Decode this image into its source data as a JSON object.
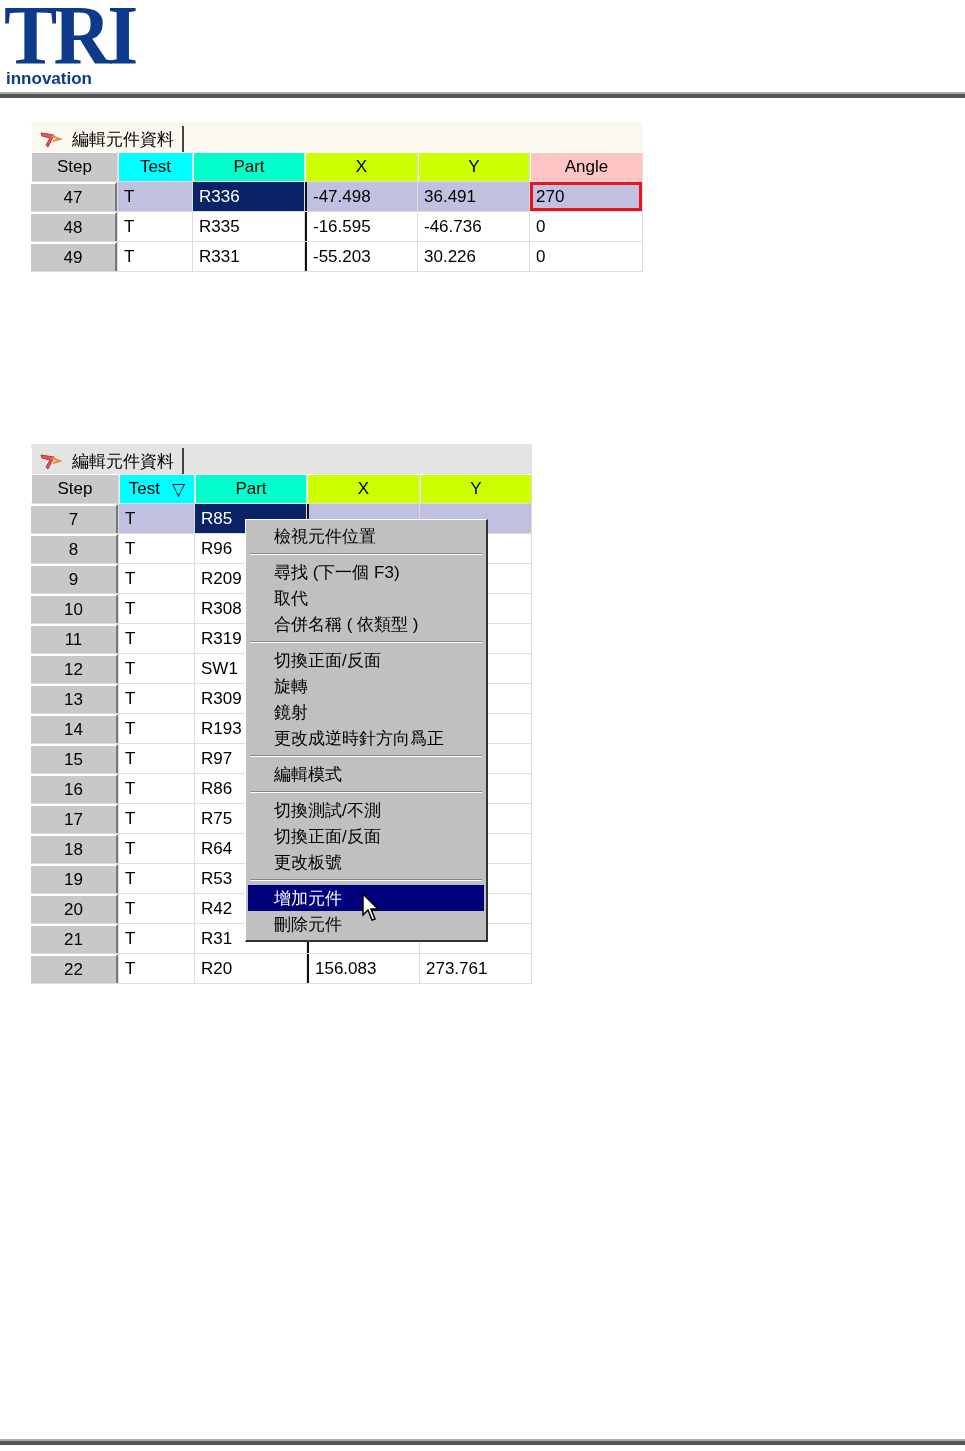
{
  "logo": {
    "mark": "TRI",
    "tagline": "innovation"
  },
  "panels": [
    {
      "title": "編輯元件資料",
      "columns": [
        {
          "label": "Step",
          "color": "#c8c8c8"
        },
        {
          "label": "Test",
          "color": "#00ffff"
        },
        {
          "label": "Part",
          "color": "#00ffcc"
        },
        {
          "label": "X",
          "color": "#ccff00"
        },
        {
          "label": "Y",
          "color": "#ccff00"
        },
        {
          "label": "Angle",
          "color": "#ffc4c4"
        }
      ],
      "rows": [
        {
          "selected": true,
          "cells": [
            "47",
            "T",
            "R336",
            "-47.498",
            "36.491",
            "270"
          ],
          "angle_outlined": true
        },
        {
          "selected": false,
          "cells": [
            "48",
            "T",
            "R335",
            "-16.595",
            "-46.736",
            "0"
          ]
        },
        {
          "selected": false,
          "cells": [
            "49",
            "T",
            "R331",
            "-55.203",
            "30.226",
            "0"
          ]
        }
      ]
    },
    {
      "title": "編輯元件資料",
      "columns": [
        {
          "label": "Step",
          "color": "#c8c8c8"
        },
        {
          "label": "Test",
          "color": "#00ffff",
          "sort_mark": "▽"
        },
        {
          "label": "Part",
          "color": "#00ffcc"
        },
        {
          "label": "X",
          "color": "#ccff00"
        },
        {
          "label": "Y",
          "color": "#ccff00"
        }
      ],
      "rows": [
        {
          "selected": true,
          "cells": [
            "7",
            "T",
            "R85",
            "",
            ""
          ]
        },
        {
          "selected": false,
          "cells": [
            "8",
            "T",
            "R96",
            "",
            ""
          ]
        },
        {
          "selected": false,
          "cells": [
            "9",
            "T",
            "R209",
            "",
            ""
          ]
        },
        {
          "selected": false,
          "cells": [
            "10",
            "T",
            "R308",
            "",
            ""
          ]
        },
        {
          "selected": false,
          "cells": [
            "11",
            "T",
            "R319",
            "",
            ""
          ]
        },
        {
          "selected": false,
          "cells": [
            "12",
            "T",
            "SW1",
            "",
            ""
          ]
        },
        {
          "selected": false,
          "cells": [
            "13",
            "T",
            "R309",
            "",
            ""
          ]
        },
        {
          "selected": false,
          "cells": [
            "14",
            "T",
            "R193",
            "",
            ""
          ]
        },
        {
          "selected": false,
          "cells": [
            "15",
            "T",
            "R97",
            "",
            ""
          ]
        },
        {
          "selected": false,
          "cells": [
            "16",
            "T",
            "R86",
            "",
            ""
          ]
        },
        {
          "selected": false,
          "cells": [
            "17",
            "T",
            "R75",
            "",
            ""
          ]
        },
        {
          "selected": false,
          "cells": [
            "18",
            "T",
            "R64",
            "",
            ""
          ]
        },
        {
          "selected": false,
          "cells": [
            "19",
            "T",
            "R53",
            "",
            ""
          ]
        },
        {
          "selected": false,
          "cells": [
            "20",
            "T",
            "R42",
            "",
            ""
          ]
        },
        {
          "selected": false,
          "cells": [
            "21",
            "T",
            "R31",
            "",
            ""
          ]
        },
        {
          "selected": false,
          "cells": [
            "22",
            "T",
            "R20",
            "156.083",
            "273.761"
          ]
        }
      ],
      "context_menu": {
        "groups": [
          [
            {
              "label": "檢視元件位置",
              "selected": false
            }
          ],
          [
            {
              "label": "尋找 (下一個 F3)",
              "selected": false
            },
            {
              "label": "取代",
              "selected": false
            },
            {
              "label": "合併名稱 ( 依類型 )",
              "selected": false
            }
          ],
          [
            {
              "label": "切換正面/反面",
              "selected": false
            },
            {
              "label": "旋轉",
              "selected": false
            },
            {
              "label": "鏡射",
              "selected": false
            },
            {
              "label": "更改成逆時針方向爲正",
              "selected": false
            }
          ],
          [
            {
              "label": "編輯模式",
              "selected": false
            }
          ],
          [
            {
              "label": "切換測試/不測",
              "selected": false
            },
            {
              "label": "切換正面/反面",
              "selected": false
            },
            {
              "label": "更改板號",
              "selected": false
            }
          ],
          [
            {
              "label": "增加元件",
              "selected": true
            },
            {
              "label": "刪除元件",
              "selected": false
            }
          ]
        ]
      }
    }
  ]
}
